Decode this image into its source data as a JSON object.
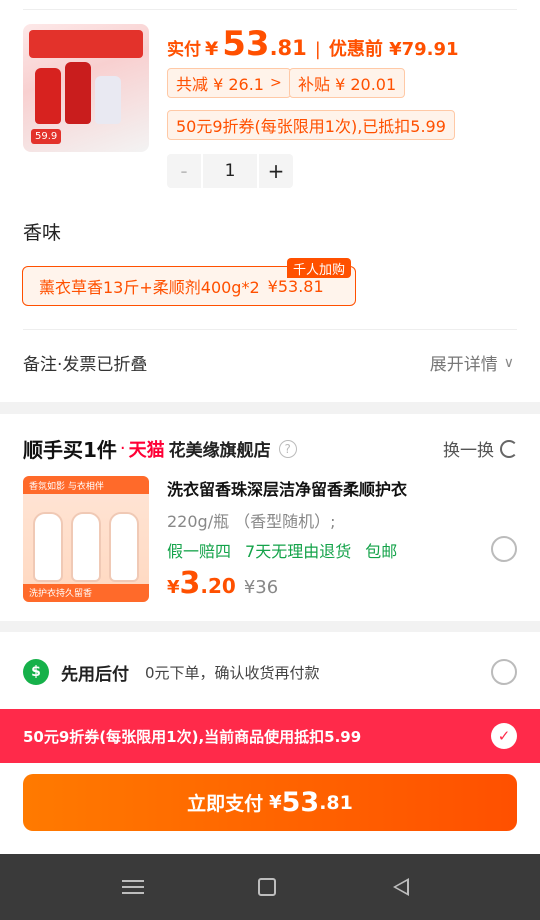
{
  "product": {
    "image_caption": "59.9",
    "price_label": "实付",
    "currency": "¥",
    "price_int": "53",
    "price_dec": ".81",
    "separator": "|",
    "before_discount": "优惠前 ¥79.91",
    "total_reduce": "共减 ¥ 26.1",
    "subsidy": "补贴 ¥ 20.01",
    "coupon_applied": "50元9折券(每张限用1次),已抵扣5.99",
    "quantity": "1",
    "minus_label": "-",
    "plus_label": "+"
  },
  "scent": {
    "title": "香味",
    "option_label": "薰衣草香13斤+柔顺剂400g*2",
    "option_price": "¥53.81",
    "badge": "千人加购"
  },
  "remark": {
    "label": "备注·发票已折叠",
    "expand_label": "展开详情"
  },
  "recommend": {
    "header": "顺手买1件",
    "dot": "·",
    "platform": "天猫",
    "store": "花美缘旗舰店",
    "info_icon": "?",
    "swap_label": "换一换",
    "image_top_text": "香氛如影 与衣相伴",
    "image_bottom_text": "洗护衣持久留香",
    "title": "洗衣留香珠深层洁净留香柔顺护衣",
    "spec": "220g/瓶 （香型随机）;",
    "tags": [
      "假一赔四",
      "7天无理由退货",
      "包邮"
    ],
    "currency": "¥",
    "price_int": "3",
    "price_dec": ".20",
    "original_price": "¥36"
  },
  "pay_later": {
    "icon_text": "$",
    "title": "先用后付",
    "desc": "0元下单，确认收货再付款"
  },
  "coupon_bar": {
    "text": "50元9折券(每张限用1次),当前商品使用抵扣5.99",
    "check": "✓"
  },
  "pay_button": {
    "label": "立即支付",
    "currency": "¥",
    "price_int": "53",
    "price_dec": ".81"
  },
  "colors": {
    "accent": "#ff5000",
    "coupon_bar": "#ff2a4a",
    "tag_green": "#14a34a"
  }
}
